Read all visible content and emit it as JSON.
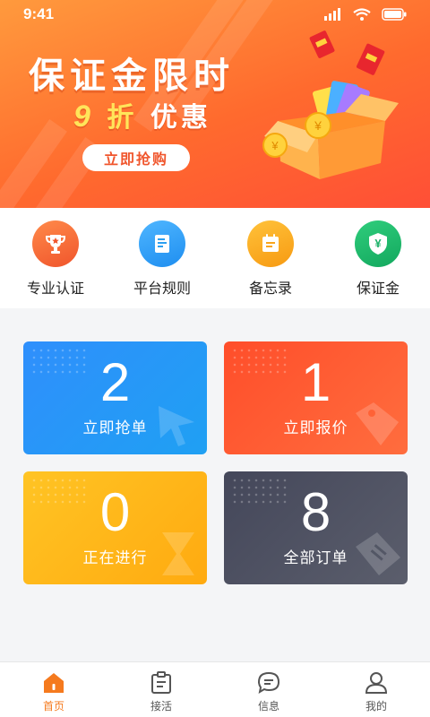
{
  "status_bar": {
    "time": "9:41"
  },
  "banner": {
    "title": "保证金限时",
    "subtitle_number": "9",
    "subtitle_unit": "折",
    "subtitle_text": "优惠",
    "button_label": "立即抢购"
  },
  "quick_menu": [
    {
      "label": "专业认证",
      "icon": "trophy-icon",
      "color": "#f6683a"
    },
    {
      "label": "平台规则",
      "icon": "rules-doc-icon",
      "color": "#2c9ff0"
    },
    {
      "label": "备忘录",
      "icon": "calendar-note-icon",
      "color": "#f9a51c"
    },
    {
      "label": "保证金",
      "icon": "yuan-shield-icon",
      "color": "#1fb26a"
    }
  ],
  "cards": [
    {
      "count": "2",
      "label": "立即抢单",
      "color_from": "#2f8ffc",
      "color_to": "#1f9ff0"
    },
    {
      "count": "1",
      "label": "立即报价",
      "color_from": "#ff5a2e",
      "color_to": "#ff6a3c"
    },
    {
      "count": "0",
      "label": "正在进行",
      "color_from": "#ffc01e",
      "color_to": "#ffab10"
    },
    {
      "count": "8",
      "label": "全部订单",
      "color_from": "#4a4d5a",
      "color_to": "#5a5d6a"
    }
  ],
  "tabs": [
    {
      "label": "首页",
      "icon": "home-icon",
      "active": true
    },
    {
      "label": "接活",
      "icon": "clipboard-icon",
      "active": false
    },
    {
      "label": "信息",
      "icon": "chat-icon",
      "active": false
    },
    {
      "label": "我的",
      "icon": "user-icon",
      "active": false
    }
  ],
  "colors": {
    "accent": "#f57a1e",
    "banner": "#ff6a2e"
  }
}
